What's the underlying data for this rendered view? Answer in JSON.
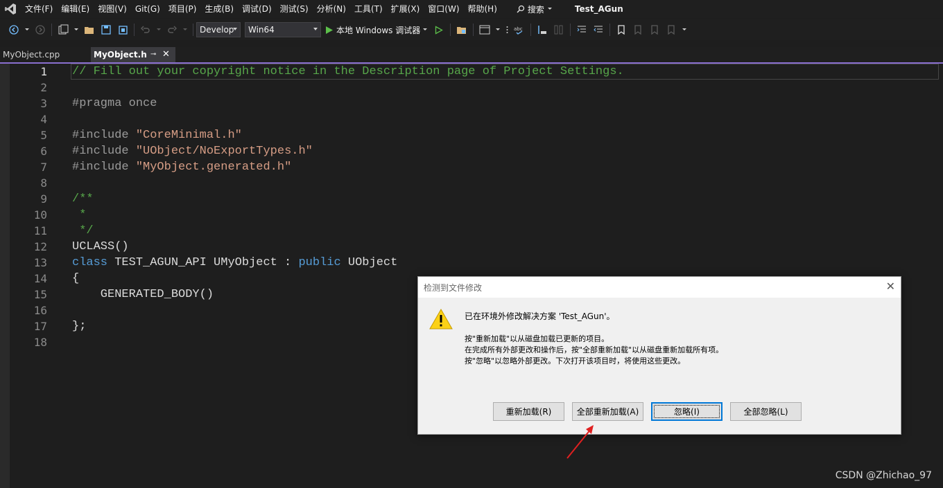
{
  "menubar": {
    "items": [
      "文件(F)",
      "编辑(E)",
      "视图(V)",
      "Git(G)",
      "项目(P)",
      "生成(B)",
      "调试(D)",
      "测试(S)",
      "分析(N)",
      "工具(T)",
      "扩展(X)",
      "窗口(W)",
      "帮助(H)"
    ],
    "search_label": "搜索",
    "solution_title": "Test_AGun"
  },
  "toolbar": {
    "configuration": "Develop",
    "platform": "Win64",
    "run_label": "本地 Windows 调试器"
  },
  "tabs": [
    {
      "label": "MyObject.cpp"
    },
    {
      "label": "MyObject.h"
    }
  ],
  "editor": {
    "line_numbers": [
      "1",
      "2",
      "3",
      "4",
      "5",
      "6",
      "7",
      "8",
      "9",
      "10",
      "11",
      "12",
      "13",
      "14",
      "15",
      "16",
      "17",
      "18"
    ],
    "lines": {
      "l1": "// Fill out your copyright notice in the Description page of Project Settings.",
      "l3": "#pragma once",
      "l5_pre": "#include ",
      "l5_str": "\"CoreMinimal.h\"",
      "l6_pre": "#include ",
      "l6_str": "\"UObject/NoExportTypes.h\"",
      "l7_pre": "#include ",
      "l7_str": "\"MyObject.generated.h\"",
      "l9": "/**",
      "l10": " *",
      "l11": " */",
      "l12": "UCLASS()",
      "l13_kw1": "class",
      "l13_mid": " TEST_AGUN_API UMyObject : ",
      "l13_kw2": "public",
      "l13_end": " UObject",
      "l14": "{",
      "l15": "    GENERATED_BODY()",
      "l17": "};"
    }
  },
  "dialog": {
    "title": "检测到文件修改",
    "main_text": "已在环境外修改解决方案 'Test_AGun'。",
    "info_lines": [
      "按\"重新加载\"以从磁盘加载已更新的项目。",
      "在完成所有外部更改和操作后，按\"全部重新加载\"以从磁盘重新加载所有项。",
      "按\"忽略\"以忽略外部更改。下次打开该项目时，将使用这些更改。"
    ],
    "buttons": [
      "重新加载(R)",
      "全部重新加载(A)",
      "忽略(I)",
      "全部忽略(L)"
    ]
  },
  "watermark": "CSDN @Zhichao_97",
  "colors": {
    "accent": "#8a6fd0",
    "comment": "#57a64a",
    "string": "#d69d85",
    "keyword": "#569cd6",
    "annotation_arrow": "#e02020"
  }
}
